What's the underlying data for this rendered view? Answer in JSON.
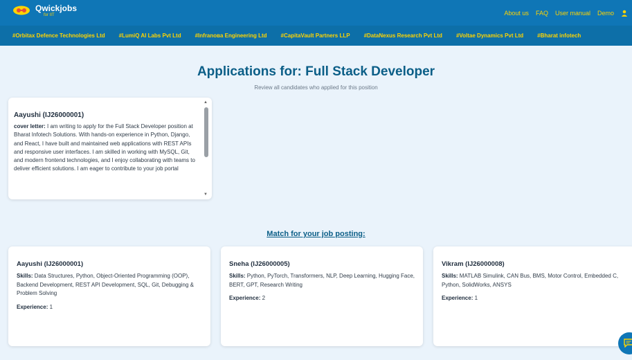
{
  "brand": {
    "name": "Qwickjobs",
    "sub": "for IIT"
  },
  "nav": {
    "items": [
      "About us",
      "FAQ",
      "User manual",
      "Demo"
    ],
    "user_icon": "user-icon"
  },
  "ticker": [
    "#Orbitax Defence Technologies Ltd",
    "#LumiQ AI Labs Pvt Ltd",
    "#Infranoва Engineering Ltd",
    "#CapitaVault Partners LLP",
    "#DataNexus Research Pvt Ltd",
    "#Voltae Dynamics Pvt Ltd",
    "#Bharat infotech"
  ],
  "page": {
    "title": "Applications for: Full Stack Developer",
    "subtitle": "Review all candidates who applied for this position"
  },
  "application": {
    "name": "Aayushi (IJ26000001)",
    "cover_label": "cover letter:",
    "cover_text": " I am writing to apply for the Full Stack Developer position at Bharat Infotech Solutions. With hands-on experience in Python, Django, and React, I have built and maintained web applications with REST APIs and responsive user interfaces. I am skilled in working with MySQL, Git, and modern frontend technologies, and I enjoy collaborating with teams to deliver efficient solutions. I am eager to contribute to your job portal"
  },
  "match": {
    "label": "Match for your job posting:"
  },
  "labels": {
    "skills": "Skills:",
    "experience": "Experience:"
  },
  "candidates": [
    {
      "name": "Aayushi (IJ26000001)",
      "skills": " Data Structures, Python, Object-Oriented Programming (OOP), Backend Development, REST API Development, SQL, Git, Debugging & Problem Solving",
      "experience": " 1"
    },
    {
      "name": "Sneha (IJ26000005)",
      "skills": " Python, PyTorch, Transformers, NLP, Deep Learning, Hugging Face, BERT, GPT, Research Writing",
      "experience": " 2"
    },
    {
      "name": "Vikram (IJ26000008)",
      "skills": " MATLAB Simulink, CAN Bus, BMS, Motor Control, Embedded C, Python, SolidWorks, ANSYS",
      "experience": " 1"
    }
  ],
  "colors": {
    "header": "#0f76b6",
    "accent": "#ffd400",
    "title": "#0b5e87",
    "background": "#eaf3fb"
  }
}
